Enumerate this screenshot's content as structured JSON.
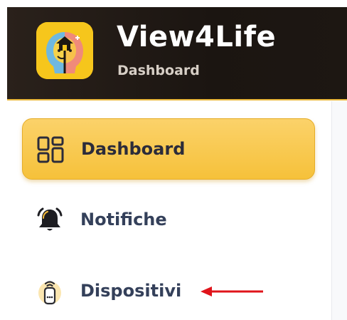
{
  "header": {
    "title": "View4Life",
    "subtitle": "Dashboard",
    "logo_icon": "view4life-logo-icon"
  },
  "sidebar": {
    "items": [
      {
        "label": "Dashboard",
        "icon": "dashboard-grid-icon",
        "active": true
      },
      {
        "label": "Notifiche",
        "icon": "bell-icon",
        "active": false
      },
      {
        "label": "Dispositivi",
        "icon": "remote-device-icon",
        "active": false
      }
    ]
  },
  "annotation": {
    "arrow_color": "#e0141b",
    "pointing_to": "Dispositivi"
  },
  "colors": {
    "header_bg": "#1d1712",
    "accent": "#f6c13a",
    "nav_text": "#34405a"
  }
}
